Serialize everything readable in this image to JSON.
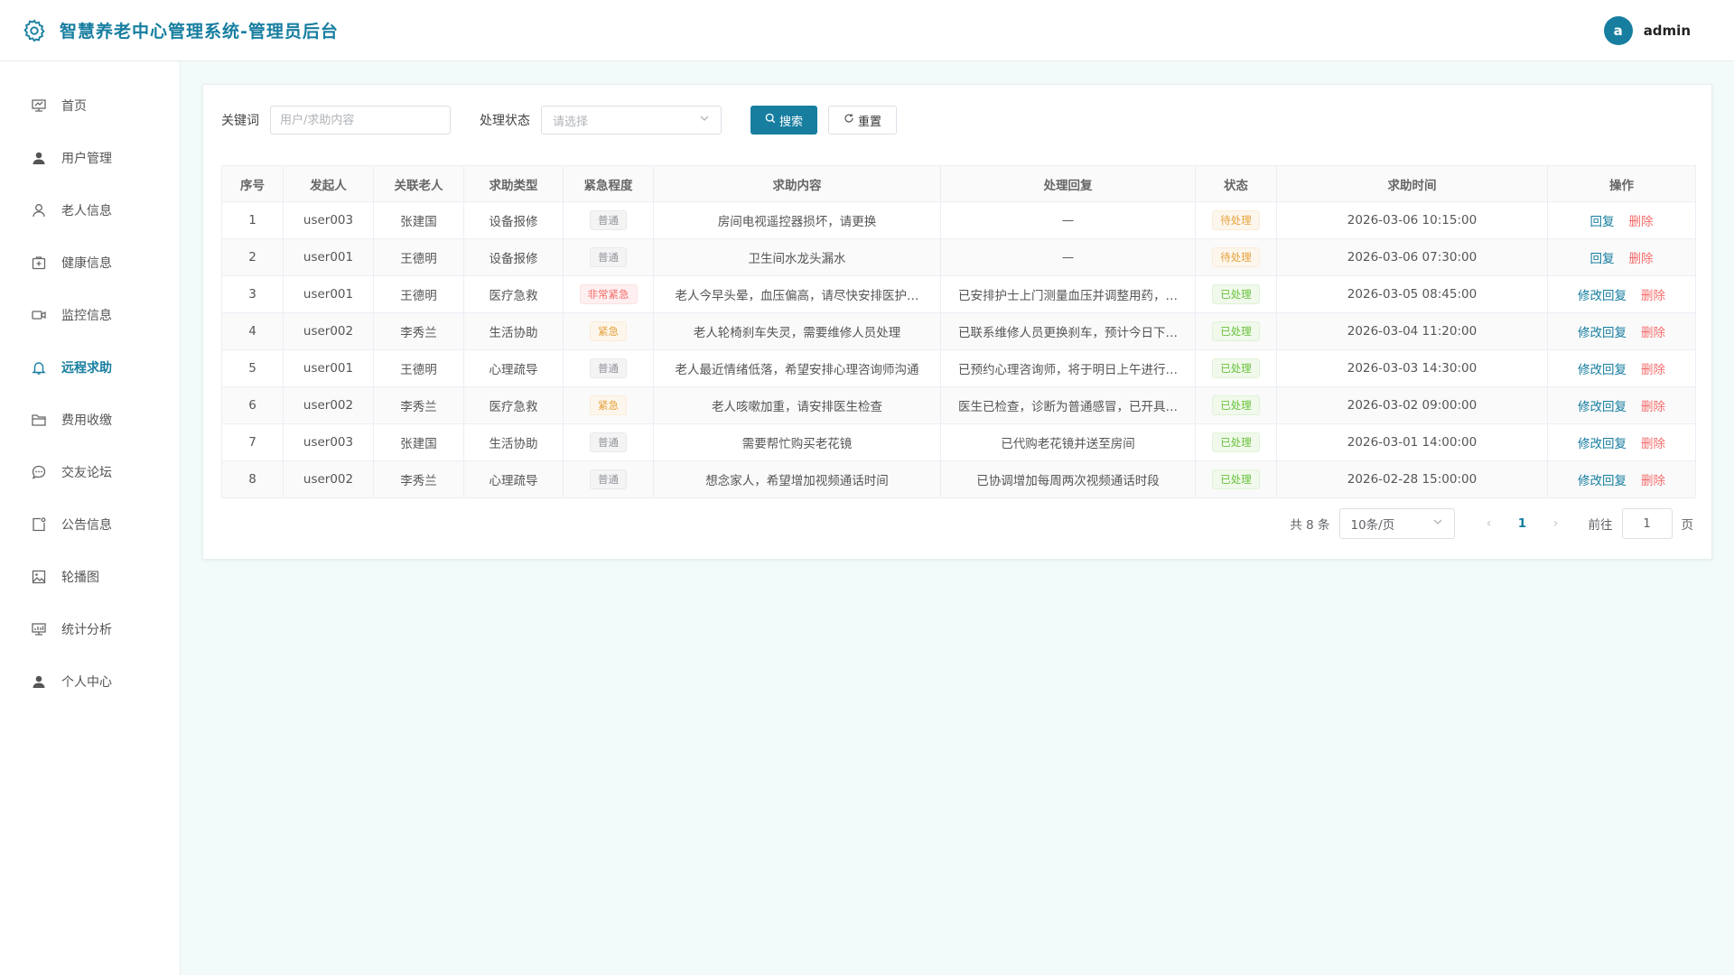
{
  "app": {
    "title": "智慧养老中心管理系统-管理员后台"
  },
  "user": {
    "avatar_letter": "a",
    "name": "admin"
  },
  "colors": {
    "primary": "#177ea0",
    "danger": "#f56c6c",
    "warning": "#e6a23c",
    "success": "#67c23a"
  },
  "sidebar": {
    "items": [
      {
        "label": "首页",
        "icon": "dashboard-icon"
      },
      {
        "label": "用户管理",
        "icon": "user-icon"
      },
      {
        "label": "老人信息",
        "icon": "person-outline-icon"
      },
      {
        "label": "健康信息",
        "icon": "first-aid-icon"
      },
      {
        "label": "监控信息",
        "icon": "camera-icon"
      },
      {
        "label": "远程求助",
        "icon": "bell-icon"
      },
      {
        "label": "费用收缴",
        "icon": "folder-icon"
      },
      {
        "label": "交友论坛",
        "icon": "chat-icon"
      },
      {
        "label": "公告信息",
        "icon": "notice-icon"
      },
      {
        "label": "轮播图",
        "icon": "picture-icon"
      },
      {
        "label": "统计分析",
        "icon": "chart-icon"
      },
      {
        "label": "个人中心",
        "icon": "user-icon"
      }
    ],
    "active_index": 5
  },
  "filters": {
    "keyword_label": "关键词",
    "keyword_placeholder": "用户/求助内容",
    "status_label": "处理状态",
    "status_placeholder": "请选择",
    "search_label": "搜索",
    "reset_label": "重置"
  },
  "table": {
    "headers": [
      "序号",
      "发起人",
      "关联老人",
      "求助类型",
      "紧急程度",
      "求助内容",
      "处理回复",
      "状态",
      "求助时间",
      "操作"
    ],
    "rows": [
      {
        "no": "1",
        "initiator": "user003",
        "elder": "张建国",
        "type": "设备报修",
        "urgency": "普通",
        "urgency_level": "normal",
        "content": "房间电视遥控器损坏，请更换",
        "reply": "—",
        "status": "待处理",
        "status_kind": "pending",
        "time": "2026-03-06 10:15:00",
        "ops": [
          "回复",
          "删除"
        ]
      },
      {
        "no": "2",
        "initiator": "user001",
        "elder": "王德明",
        "type": "设备报修",
        "urgency": "普通",
        "urgency_level": "normal",
        "content": "卫生间水龙头漏水",
        "reply": "—",
        "status": "待处理",
        "status_kind": "pending",
        "time": "2026-03-06 07:30:00",
        "ops": [
          "回复",
          "删除"
        ]
      },
      {
        "no": "3",
        "initiator": "user001",
        "elder": "王德明",
        "type": "医疗急救",
        "urgency": "非常紧急",
        "urgency_level": "critical",
        "content": "老人今早头晕，血压偏高，请尽快安排医护…",
        "reply": "已安排护士上门测量血压并调整用药，…",
        "status": "已处理",
        "status_kind": "done",
        "time": "2026-03-05 08:45:00",
        "ops": [
          "修改回复",
          "删除"
        ]
      },
      {
        "no": "4",
        "initiator": "user002",
        "elder": "李秀兰",
        "type": "生活协助",
        "urgency": "紧急",
        "urgency_level": "urgent",
        "content": "老人轮椅刹车失灵，需要维修人员处理",
        "reply": "已联系维修人员更换刹车，预计今日下…",
        "status": "已处理",
        "status_kind": "done",
        "time": "2026-03-04 11:20:00",
        "ops": [
          "修改回复",
          "删除"
        ]
      },
      {
        "no": "5",
        "initiator": "user001",
        "elder": "王德明",
        "type": "心理疏导",
        "urgency": "普通",
        "urgency_level": "normal",
        "content": "老人最近情绪低落，希望安排心理咨询师沟通",
        "reply": "已预约心理咨询师，将于明日上午进行…",
        "status": "已处理",
        "status_kind": "done",
        "time": "2026-03-03 14:30:00",
        "ops": [
          "修改回复",
          "删除"
        ]
      },
      {
        "no": "6",
        "initiator": "user002",
        "elder": "李秀兰",
        "type": "医疗急救",
        "urgency": "紧急",
        "urgency_level": "urgent",
        "content": "老人咳嗽加重，请安排医生检查",
        "reply": "医生已检查，诊断为普通感冒，已开具…",
        "status": "已处理",
        "status_kind": "done",
        "time": "2026-03-02 09:00:00",
        "ops": [
          "修改回复",
          "删除"
        ]
      },
      {
        "no": "7",
        "initiator": "user003",
        "elder": "张建国",
        "type": "生活协助",
        "urgency": "普通",
        "urgency_level": "normal",
        "content": "需要帮忙购买老花镜",
        "reply": "已代购老花镜并送至房间",
        "status": "已处理",
        "status_kind": "done",
        "time": "2026-03-01 14:00:00",
        "ops": [
          "修改回复",
          "删除"
        ]
      },
      {
        "no": "8",
        "initiator": "user002",
        "elder": "李秀兰",
        "type": "心理疏导",
        "urgency": "普通",
        "urgency_level": "normal",
        "content": "想念家人，希望增加视频通话时间",
        "reply": "已协调增加每周两次视频通话时段",
        "status": "已处理",
        "status_kind": "done",
        "time": "2026-02-28 15:00:00",
        "ops": [
          "修改回复",
          "删除"
        ]
      }
    ]
  },
  "pagination": {
    "total_text": "共 8 条",
    "page_size": "10条/页",
    "current_page": "1",
    "goto_label": "前往",
    "goto_value": "1",
    "page_suffix": "页"
  }
}
